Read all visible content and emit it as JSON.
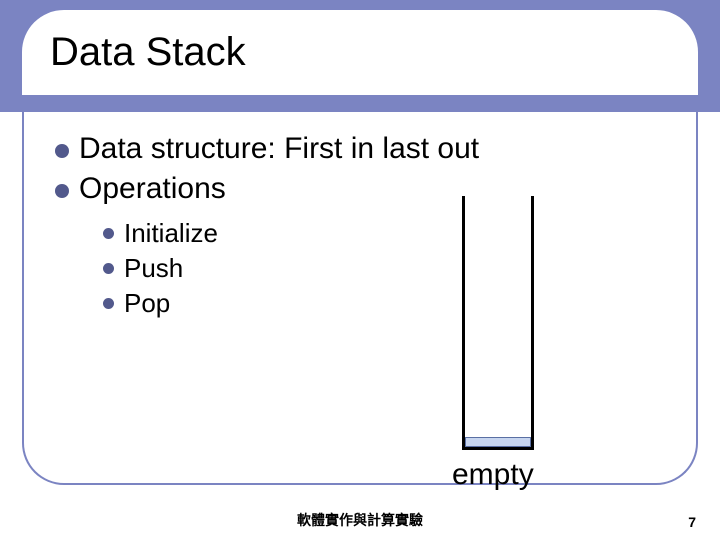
{
  "title": "Data Stack",
  "bullets": {
    "main": [
      "Data structure: First in last out",
      "Operations"
    ],
    "sub": [
      "Initialize",
      "Push",
      "Pop"
    ]
  },
  "stack_label": "empty",
  "footer_text": "軟體實作與計算實驗",
  "page_number": "7"
}
